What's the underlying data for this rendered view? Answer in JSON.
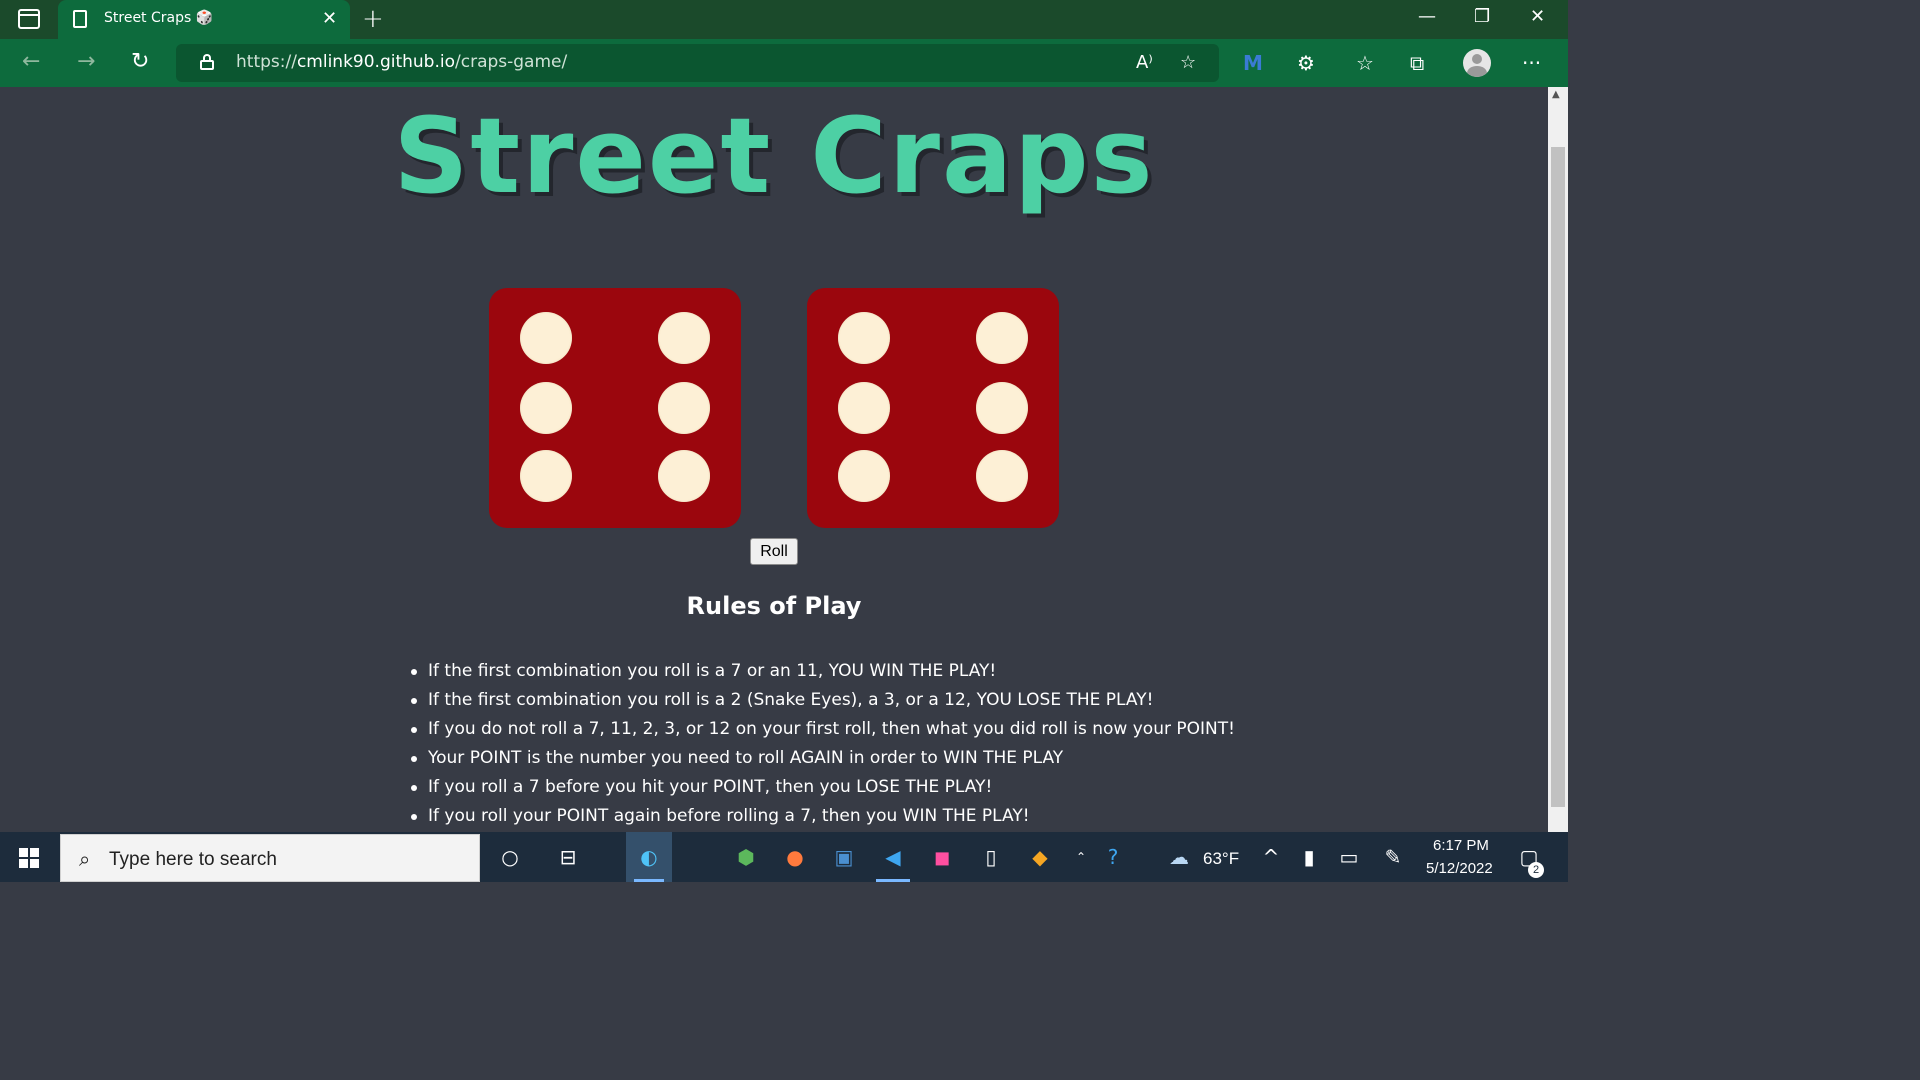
{
  "browser": {
    "tab_title": "Street Craps 🎲",
    "tab_close": "✕",
    "new_tab": "+",
    "url_scheme": "https://",
    "url_host": "cmlink90.github.io",
    "url_path": "/craps-game/",
    "window_controls": {
      "minimize": "—",
      "restore": "❐",
      "close": "✕"
    },
    "menu": "···"
  },
  "game": {
    "title": "Street Craps",
    "dice": [
      6,
      6
    ],
    "roll_label": "Roll"
  },
  "rules": {
    "title": "Rules of Play",
    "items": [
      "If the first combination you roll is a 7 or an 11, YOU WIN THE PLAY!",
      "If the first combination you roll is a 2 (Snake Eyes), a 3, or a 12, YOU LOSE THE PLAY!",
      "If you do not roll a 7, 11, 2, 3, or 12 on your first roll, then what you did roll is now your POINT!",
      "Your POINT is the number you need to roll AGAIN in order to WIN THE PLAY",
      "If you roll a 7 before you hit your POINT, then you LOSE THE PLAY!",
      "If you roll your POINT again before rolling a 7, then you WIN THE PLAY!"
    ]
  },
  "taskbar": {
    "search_placeholder": "Type here to search",
    "weather": "63°F",
    "time": "6:17 PM",
    "date": "5/12/2022",
    "notifications": "2"
  },
  "colors": {
    "title": "#4dd0a4",
    "die": "#9b060d",
    "pip": "#fdf0d6",
    "page_bg": "#373b45",
    "browser": "#0d6b3d"
  }
}
